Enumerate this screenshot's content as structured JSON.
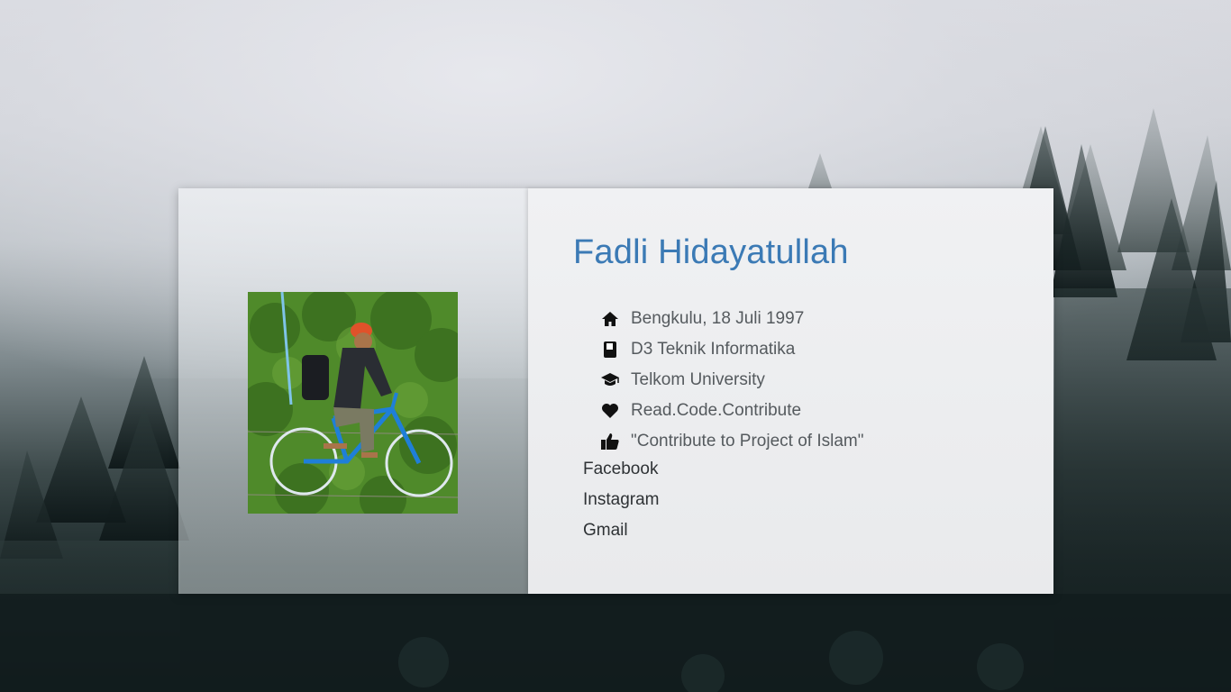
{
  "profile": {
    "name": "Fadli Hidayatullah",
    "photo_alt": "profile-photo"
  },
  "info": [
    {
      "icon": "home-icon",
      "text": "Bengkulu, 18 Juli 1997"
    },
    {
      "icon": "book-icon",
      "text": "D3 Teknik Informatika"
    },
    {
      "icon": "graduation-cap-icon",
      "text": "Telkom University"
    },
    {
      "icon": "heart-icon",
      "text": "Read.Code.Contribute"
    },
    {
      "icon": "thumbs-up-icon",
      "text": "\"Contribute to Project of Islam\""
    }
  ],
  "links": [
    {
      "label": "Facebook"
    },
    {
      "label": "Instagram"
    },
    {
      "label": "Gmail"
    }
  ],
  "colors": {
    "name": "#3b7ab5",
    "info_text": "#555a5e",
    "link_text": "#2e3235"
  }
}
